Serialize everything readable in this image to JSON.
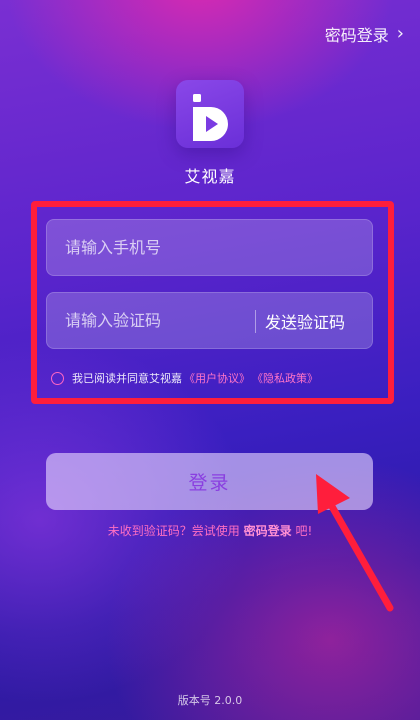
{
  "header": {
    "password_login_link": "密码登录",
    "chevron_icon": "chevron-right-icon"
  },
  "app": {
    "name": "艾视嘉",
    "logo_icon": "app-logo-icon"
  },
  "form": {
    "phone_placeholder": "请输入手机号",
    "code_placeholder": "请输入验证码",
    "send_code_label": "发送验证码",
    "agreement_prefix": "我已阅读并同意艾视嘉",
    "user_agreement": "《用户协议》",
    "privacy_policy": "《隐私政策》"
  },
  "login_button_label": "登录",
  "hint": {
    "prefix": "未收到验证码？尝试使用",
    "password_login": "密码登录",
    "suffix": "吧!"
  },
  "version": "版本号 2.0.0",
  "colors": {
    "annotation_red": "#ff1e3c",
    "accent_pink": "#ff6fc3",
    "button_text": "#8a3fe0"
  }
}
